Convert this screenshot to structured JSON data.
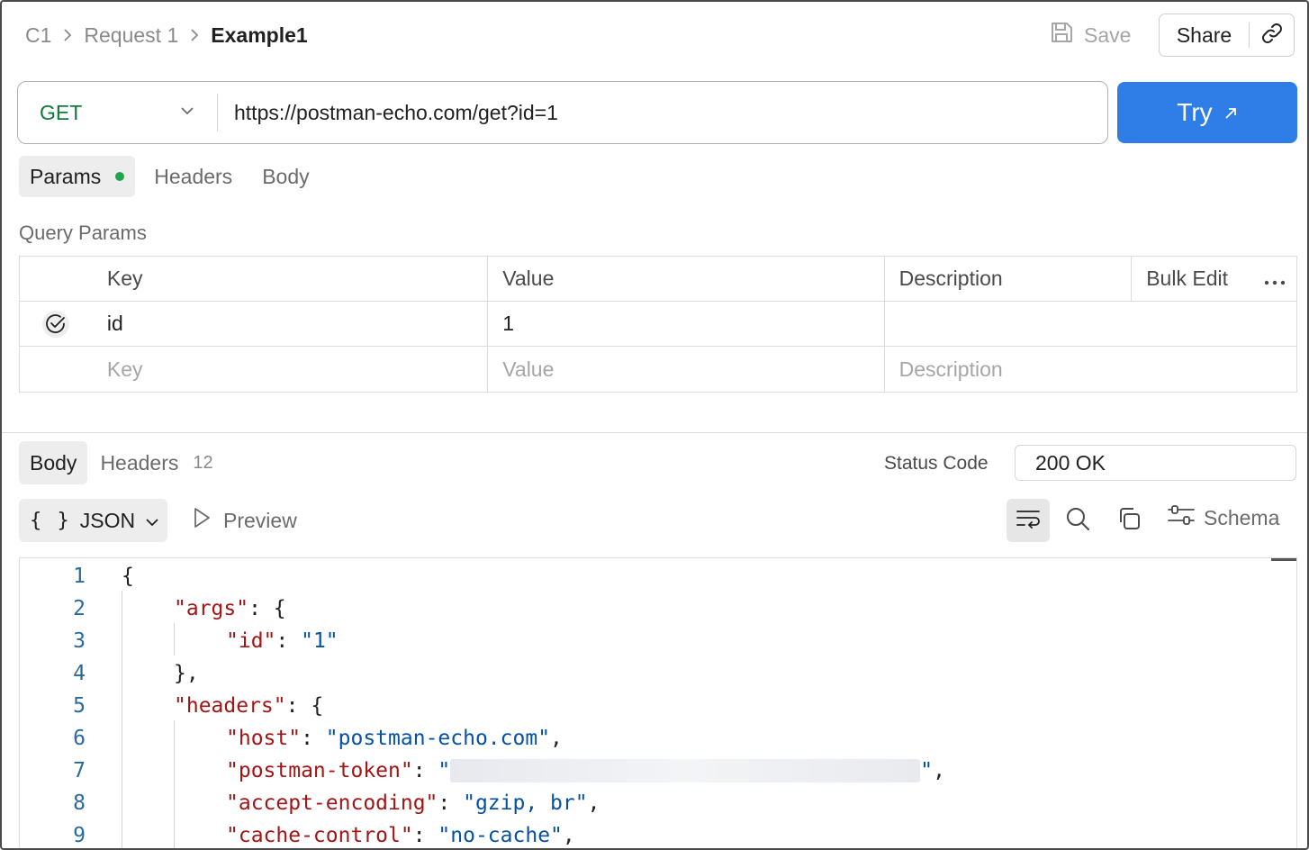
{
  "breadcrumb": {
    "items": [
      "C1",
      "Request 1"
    ],
    "current": "Example1"
  },
  "toolbar": {
    "save_label": "Save",
    "share_label": "Share"
  },
  "request": {
    "method": "GET",
    "url": "https://postman-echo.com/get?id=1",
    "try_label": "Try",
    "tabs": [
      {
        "label": "Params",
        "active": true,
        "has_dot": true
      },
      {
        "label": "Headers",
        "active": false
      },
      {
        "label": "Body",
        "active": false
      }
    ]
  },
  "query_params": {
    "title": "Query Params",
    "columns": {
      "key": "Key",
      "value": "Value",
      "description": "Description",
      "bulk_edit": "Bulk Edit"
    },
    "rows": [
      {
        "enabled": true,
        "key": "id",
        "value": "1",
        "description": ""
      }
    ],
    "placeholders": {
      "key": "Key",
      "value": "Value",
      "description": "Description"
    }
  },
  "response": {
    "tabs": [
      {
        "label": "Body",
        "active": true
      },
      {
        "label": "Headers",
        "active": false,
        "count": "12"
      }
    ],
    "status_label": "Status Code",
    "status_value": "200 OK",
    "format": {
      "braces": "{ }",
      "label": "JSON"
    },
    "preview_label": "Preview",
    "schema_label": "Schema",
    "lines": [
      "1",
      "2",
      "3",
      "4",
      "5",
      "6",
      "7",
      "8",
      "9"
    ],
    "code": {
      "l1": "{",
      "args_key": "\"args\"",
      "id_key": "\"id\"",
      "id_val": "\"1\"",
      "close_args": "},",
      "headers_key": "\"headers\"",
      "host_key": "\"host\"",
      "host_val": "\"postman-echo.com\"",
      "token_key": "\"postman-token\"",
      "enc_key": "\"accept-encoding\"",
      "enc_val": "\"gzip, br\"",
      "cache_key": "\"cache-control\"",
      "cache_val": "\"no-cache\""
    }
  },
  "colors": {
    "accent": "#2f7ee8",
    "method_get": "#0f7b3b",
    "json_key": "#a31515",
    "json_string": "#0451a5",
    "dot": "#21a54a"
  }
}
